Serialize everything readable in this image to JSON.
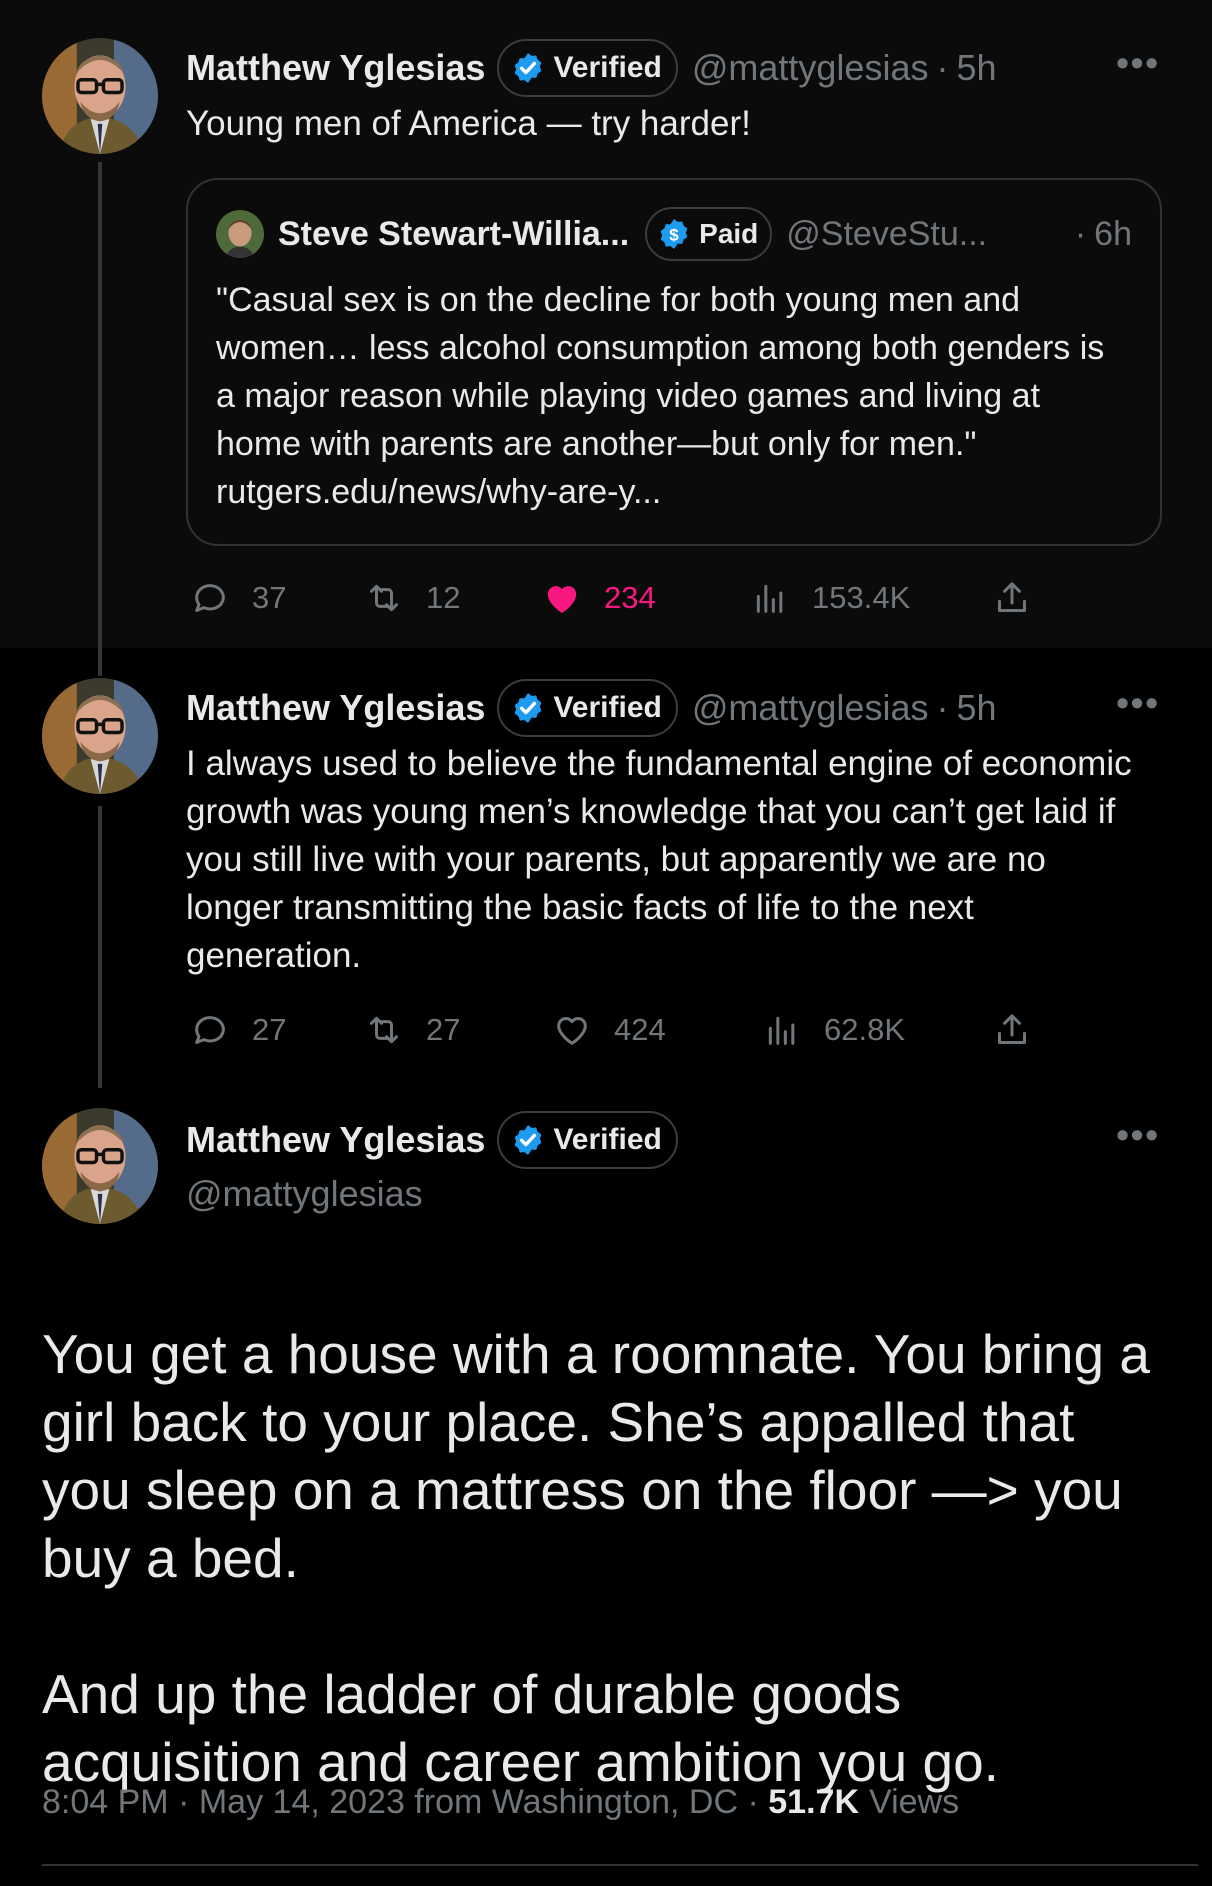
{
  "tweets": [
    {
      "name": "Matthew Yglesias",
      "badge": "Verified",
      "handle": "@mattyglesias",
      "time": "5h",
      "text": "Young men of America — try harder!",
      "quote": {
        "name": "Steve Stewart-Willia...",
        "badge": "Paid",
        "handle": "@SteveStu...",
        "time": "6h",
        "text": "\"Casual sex is on the decline for both young men and women… less alcohol consumption among both genders is a major reason while playing video games and living at home with parents are another—but only for men.\" rutgers.edu/news/why-are-y..."
      },
      "replies": "37",
      "reposts": "12",
      "likes": "234",
      "liked": true,
      "views": "153.4K"
    },
    {
      "name": "Matthew Yglesias",
      "badge": "Verified",
      "handle": "@mattyglesias",
      "time": "5h",
      "text": "I always used to believe the fundamental engine of economic growth was young men’s knowledge that you can’t get laid if you still live with your parents, but apparently we are no longer transmitting the basic facts of life to the next generation.",
      "replies": "27",
      "reposts": "27",
      "likes": "424",
      "liked": false,
      "views": "62.8K"
    }
  ],
  "main": {
    "name": "Matthew Yglesias",
    "badge": "Verified",
    "handle": "@mattyglesias",
    "paragraph1": "You get a house with a roomnate. You bring a girl back to your place. She’s appalled that you sleep on a mattress on the floor —> you buy a bed.",
    "paragraph2": "And up the ladder of durable goods acquisition and career ambition you go.",
    "timestamp": "8:04 PM · May 14, 2023 from Washington, DC · ",
    "views_count": "51.7K",
    "views_label": "Views"
  },
  "colors": {
    "verified": "#1d9bf0",
    "like": "#f91880",
    "secondary_text": "#71767b"
  }
}
